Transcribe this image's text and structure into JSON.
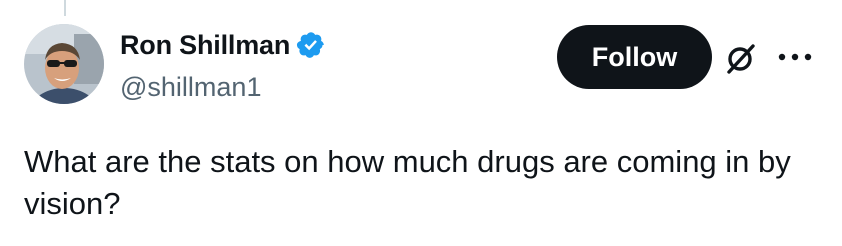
{
  "author": {
    "display_name": "Ron Shillman",
    "handle": "@shillman1",
    "verified": true
  },
  "actions": {
    "follow_label": "Follow",
    "grok_icon": "grok-slash-circle-icon",
    "more_icon": "more-horizontal-icon"
  },
  "tweet": {
    "text": "What are the stats on how much drugs are coming in by vision?"
  },
  "colors": {
    "verified_blue": "#1d9bf0",
    "text_primary": "#0f1419",
    "text_secondary": "#536471",
    "follow_bg": "#0f1419"
  }
}
